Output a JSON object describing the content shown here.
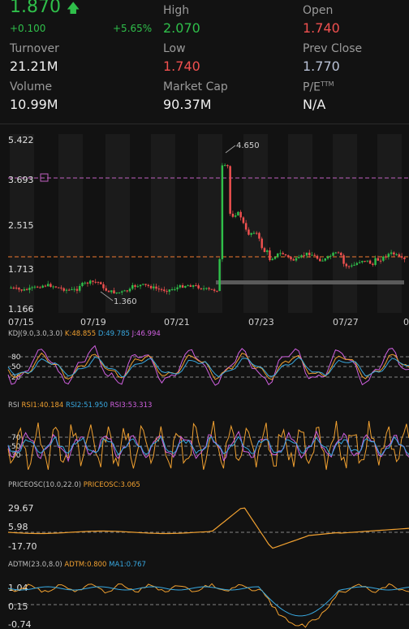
{
  "quote": {
    "price": "1.870",
    "change": "+0.100",
    "change_pct": "+5.65%",
    "high_label": "High",
    "high": "2.070",
    "open_label": "Open",
    "open": "1.740",
    "turnover_label": "Turnover",
    "turnover": "21.21M",
    "low_label": "Low",
    "low": "1.740",
    "prev_close_label": "Prev Close",
    "prev_close": "1.770",
    "volume_label": "Volume",
    "volume": "10.99M",
    "market_cap_label": "Market Cap",
    "market_cap": "90.37M",
    "pe_label": "P/E",
    "pe_sup": "TTM",
    "pe": "N/A"
  },
  "colors": {
    "up": "#2fbf4a",
    "down": "#f0504f",
    "bg": "#121212",
    "orange": "#f0a030",
    "blue": "#38a8e0",
    "magenta": "#d060e0",
    "pink": "#c060c0"
  },
  "main_chart": {
    "y_labels": [
      "5.422",
      "3.693",
      "2.515",
      "1.713",
      "1.166"
    ],
    "x_labels": [
      "07/15",
      "07/19",
      "07/21",
      "07/23",
      "07/27",
      "0"
    ],
    "annotation_high": "4.650",
    "annotation_low": "1.360",
    "marker_icon": "square-marker-icon"
  },
  "kdj": {
    "title": "KDJ(9.0,3.0,3.0)",
    "k": "K:48.855",
    "d": "D:49.785",
    "j": "J:46.994",
    "levels": [
      "80",
      "50",
      "20"
    ]
  },
  "rsi": {
    "title": "RSI",
    "rsi1": "RSI1:40.184",
    "rsi2": "RSI2:51.950",
    "rsi3": "RSI3:53.313",
    "levels": [
      "70",
      "50",
      "30"
    ]
  },
  "priceosc": {
    "title": "PRICEOSC(10.0,22.0)",
    "value": "PRICEOSC:3.065",
    "levels": [
      "29.67",
      "5.98",
      "-17.70"
    ]
  },
  "adtm": {
    "title": "ADTM(23.0,8.0)",
    "adtm": "ADTM:0.800",
    "ma1": "MA1:0.767",
    "levels": [
      "1.04",
      "0.15",
      "-0.74"
    ]
  }
}
